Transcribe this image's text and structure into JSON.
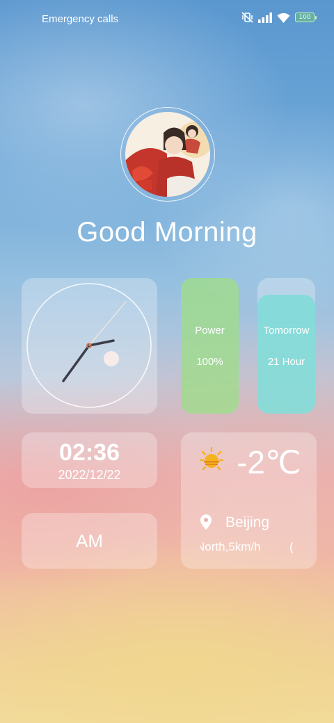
{
  "status_bar": {
    "carrier_text": "Emergency calls",
    "battery_level": "100",
    "icons": [
      "vibrate-off-icon",
      "signal-icon",
      "wifi-icon",
      "battery-icon"
    ]
  },
  "greeting": "Good Morning",
  "clock": {
    "hour_hand": "hour",
    "minute_hand": "minute",
    "second_hand": "second"
  },
  "power": {
    "label": "Power",
    "value": "100%",
    "fill_percent": 100,
    "color": "#a0dc8c"
  },
  "tomorrow": {
    "label": "Tomorrow",
    "value": "21 Hour",
    "fill_fraction": 0.875,
    "color": "#7ddcd7"
  },
  "time": {
    "time": "02:36",
    "date": "2022/12/22",
    "period": "AM"
  },
  "weather": {
    "temperature": "-2℃",
    "city": "Beijing",
    "wind": "North,5km/h",
    "extra": "(",
    "icons": [
      "sun-icon",
      "location-pin-icon"
    ]
  }
}
